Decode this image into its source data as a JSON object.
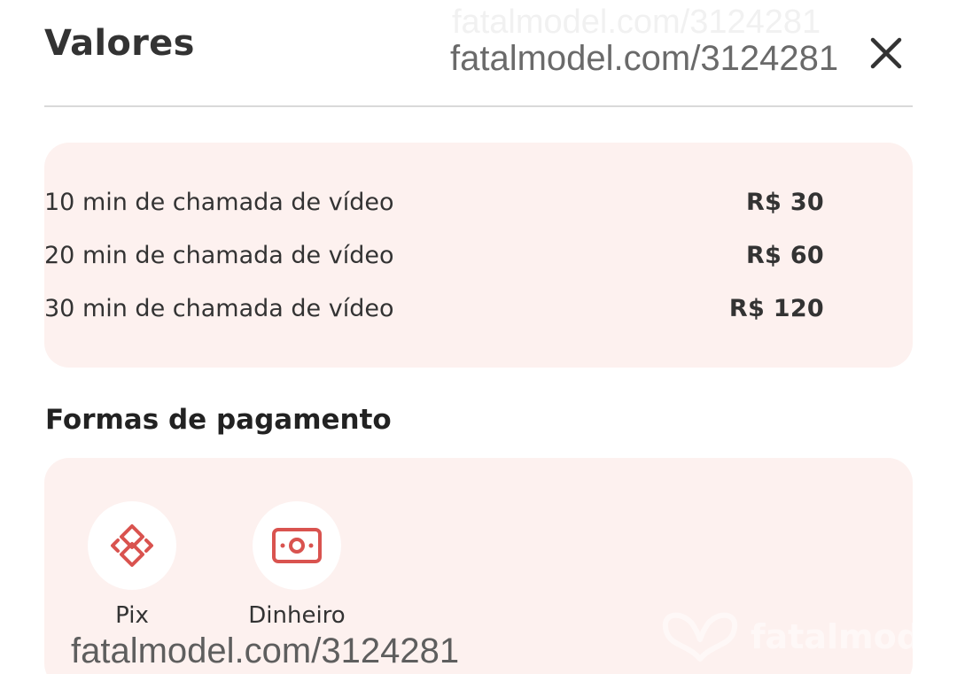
{
  "dialog": {
    "title": "Valores",
    "close_icon": "close-icon"
  },
  "prices": [
    {
      "label": "10 min de chamada de vídeo",
      "amount": "R$ 30"
    },
    {
      "label": "20 min de chamada de vídeo",
      "amount": "R$ 60"
    },
    {
      "label": "30 min de chamada de vídeo",
      "amount": "R$ 120"
    }
  ],
  "payment": {
    "title": "Formas de pagamento",
    "methods": [
      {
        "label": "Pix",
        "icon": "pix-icon"
      },
      {
        "label": "Dinheiro",
        "icon": "cash-icon"
      }
    ]
  },
  "watermark": {
    "url": "fatalmodel.com/3124281",
    "brand": "fatalmod"
  },
  "colors": {
    "card_background": "#fdf1ef",
    "icon_accent": "#d9534f",
    "text": "#333333"
  }
}
